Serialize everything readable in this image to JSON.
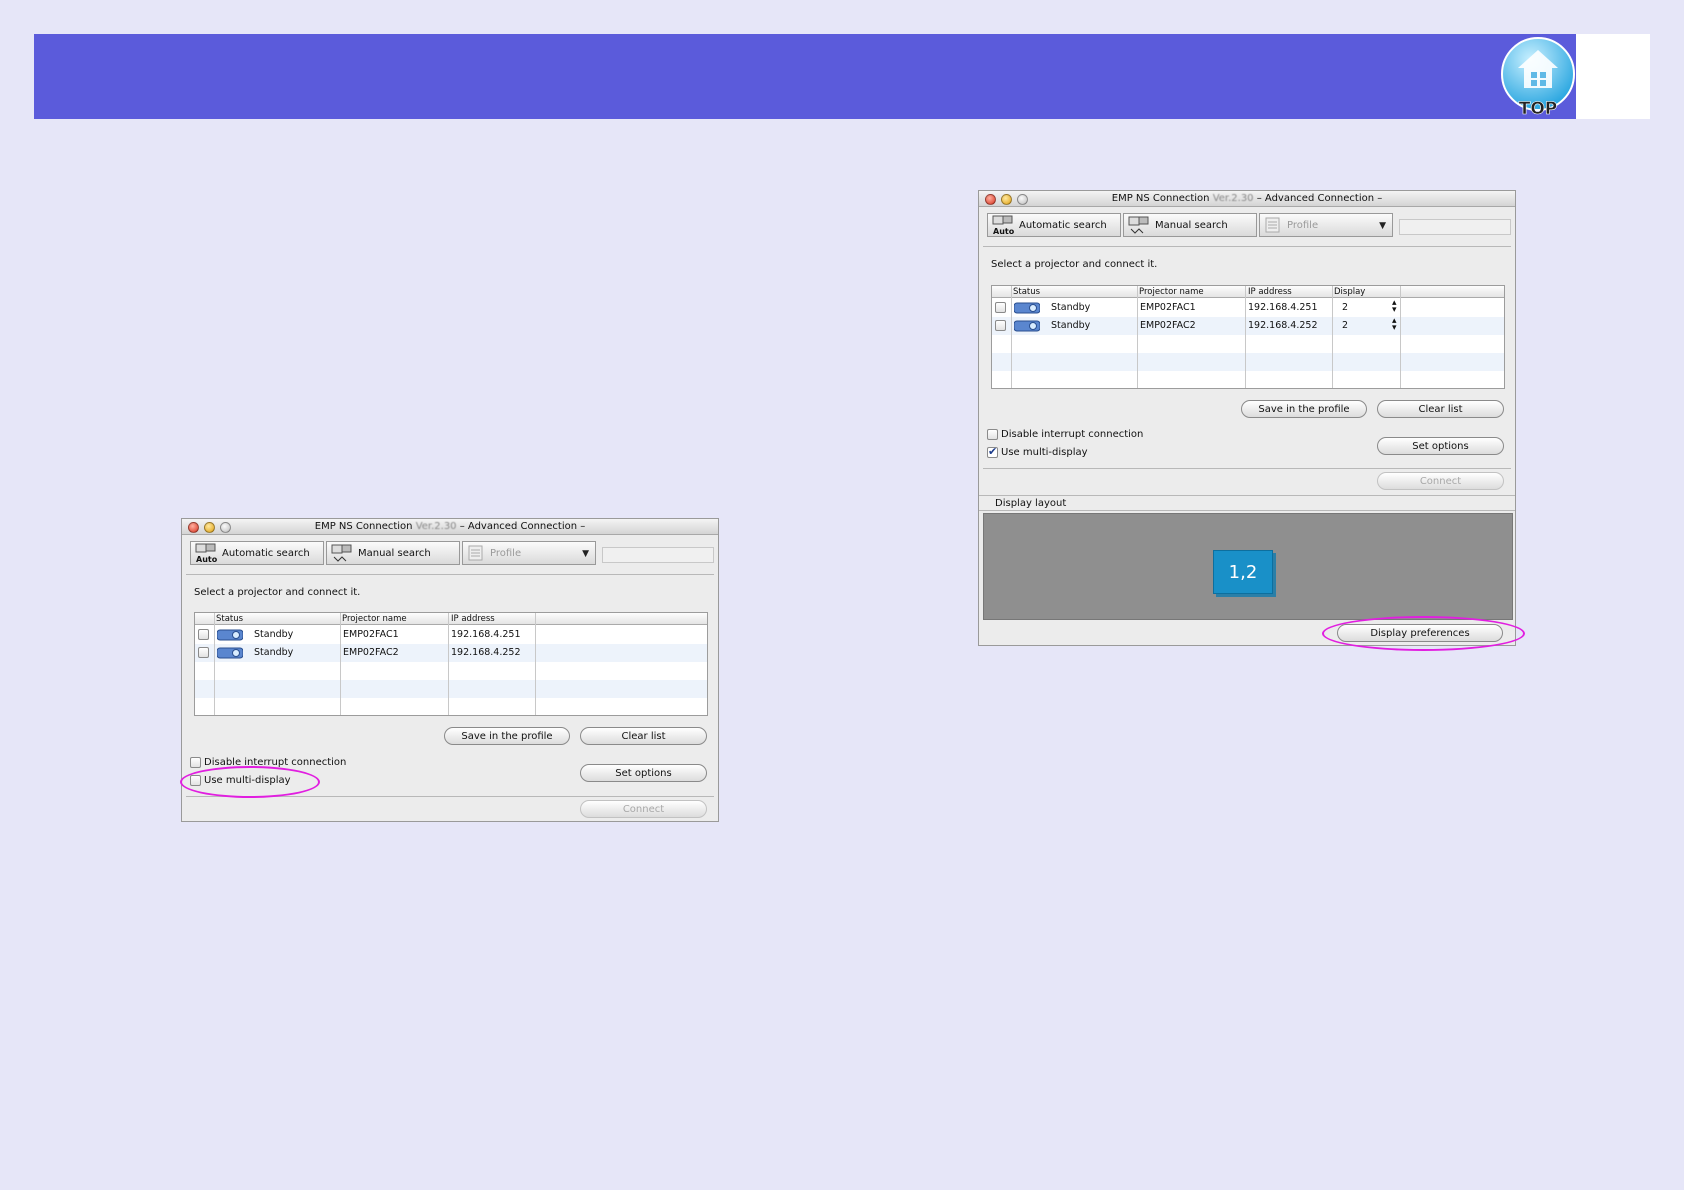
{
  "header": {
    "top_label": "TOP"
  },
  "left_window": {
    "title_main": "EMP NS Connection",
    "title_version": "Ver.2.30",
    "title_suffix": "– Advanced Connection –",
    "toolbar": {
      "auto_search": "Automatic search",
      "manual_search": "Manual search",
      "profile": "Profile",
      "auto_icon_text": "Auto"
    },
    "prompt": "Select a projector and connect it.",
    "columns": [
      "Status",
      "Projector name",
      "IP address"
    ],
    "rows": [
      {
        "status": "Standby",
        "name": "EMP02FAC1",
        "ip": "192.168.4.251"
      },
      {
        "status": "Standby",
        "name": "EMP02FAC2",
        "ip": "192.168.4.252"
      }
    ],
    "buttons": {
      "save_profile": "Save in the profile",
      "clear_list": "Clear list",
      "set_options": "Set options",
      "connect": "Connect"
    },
    "options": {
      "disable_interrupt": "Disable interrupt connection",
      "use_multi_display": "Use multi-display",
      "use_multi_display_checked": false
    }
  },
  "right_window": {
    "title_main": "EMP NS Connection",
    "title_version": "Ver.2.30",
    "title_suffix": "– Advanced Connection –",
    "toolbar": {
      "auto_search": "Automatic search",
      "manual_search": "Manual search",
      "profile": "Profile",
      "auto_icon_text": "Auto"
    },
    "prompt": "Select a projector and connect it.",
    "columns": [
      "Status",
      "Projector name",
      "IP address",
      "Display"
    ],
    "rows": [
      {
        "status": "Standby",
        "name": "EMP02FAC1",
        "ip": "192.168.4.251",
        "display": "2"
      },
      {
        "status": "Standby",
        "name": "EMP02FAC2",
        "ip": "192.168.4.252",
        "display": "2"
      }
    ],
    "buttons": {
      "save_profile": "Save in the profile",
      "clear_list": "Clear list",
      "set_options": "Set options",
      "connect": "Connect",
      "display_preferences": "Display preferences"
    },
    "options": {
      "disable_interrupt": "Disable interrupt connection",
      "use_multi_display": "Use multi-display",
      "use_multi_display_checked": true
    },
    "display_layout": {
      "label": "Display layout",
      "box_label": "1,2"
    }
  },
  "colors": {
    "banner": "#5b5bdb",
    "highlight": "#e11ee0",
    "display_box": "#1990c8"
  }
}
